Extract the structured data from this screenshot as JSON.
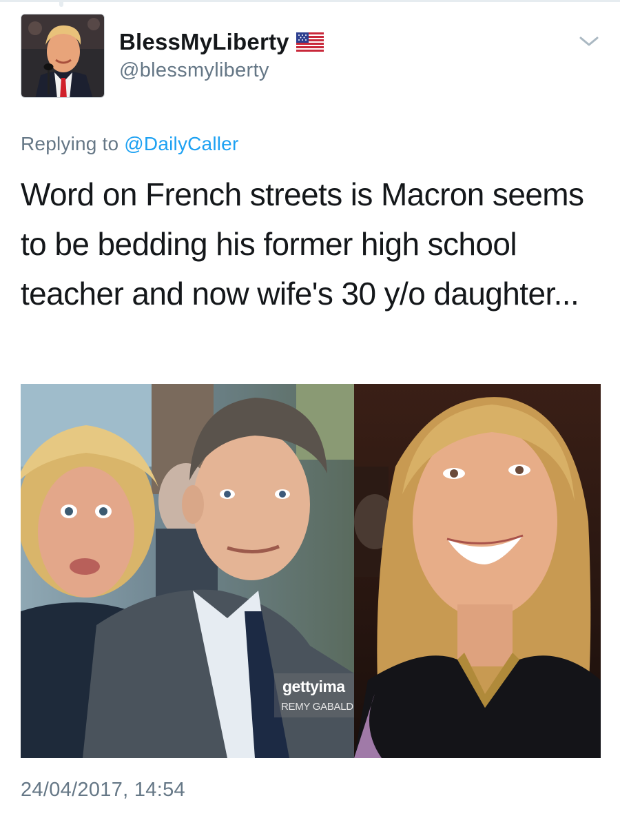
{
  "user": {
    "display_name": "BlessMyLiberty",
    "handle": "@blessmyliberty",
    "flag_icon": "us-flag-icon"
  },
  "reply": {
    "prefix": "Replying to",
    "target": "@DailyCaller"
  },
  "tweet": {
    "text": "Word on French streets is Macron seems to be bedding his former high school teacher and now wife's 30 y/o daughter..."
  },
  "media": {
    "watermark_brand": "gettyima",
    "watermark_credit": "REMY GABALD"
  },
  "timestamp": "24/04/2017, 14:54",
  "colors": {
    "link": "#1da1f2",
    "secondary_text": "#657786",
    "primary_text": "#14171a"
  }
}
